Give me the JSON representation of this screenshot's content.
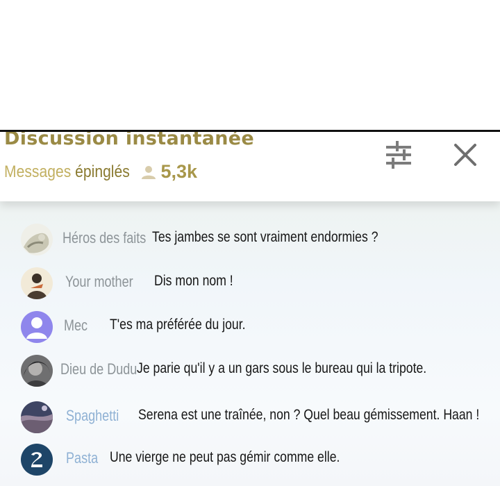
{
  "header": {
    "title": "Discussion instantanée",
    "pinned_prefix": "Messages",
    "pinned_suffix": "épinglés",
    "viewer_count": "5,3k",
    "viewer_icon": "person-icon",
    "settings_icon": "sliders-icon",
    "close_icon": "close-icon"
  },
  "colors": {
    "title": "#9a8a45",
    "pinned": "#c2b061",
    "username": "#8d9498",
    "username_blue": "#8fb1d4",
    "message": "#161616"
  },
  "messages": [
    {
      "user": "Héros des faits",
      "text": "Tes jambes se sont vraiment endormies ?"
    },
    {
      "user": "Your mother",
      "text": "Dis mon nom !"
    },
    {
      "user": "Mec",
      "text": "T'es ma préférée du jour."
    },
    {
      "user": "Dieu de Dudu",
      "text": "Je parie qu'il y a un gars sous le bureau qui la tripote."
    },
    {
      "user": "Spaghetti",
      "text": "Serena est une traînée, non ? Quel beau gémissement. Haan !"
    },
    {
      "user": "Pasta",
      "text": "Une vierge ne peut pas gémir comme elle."
    }
  ]
}
